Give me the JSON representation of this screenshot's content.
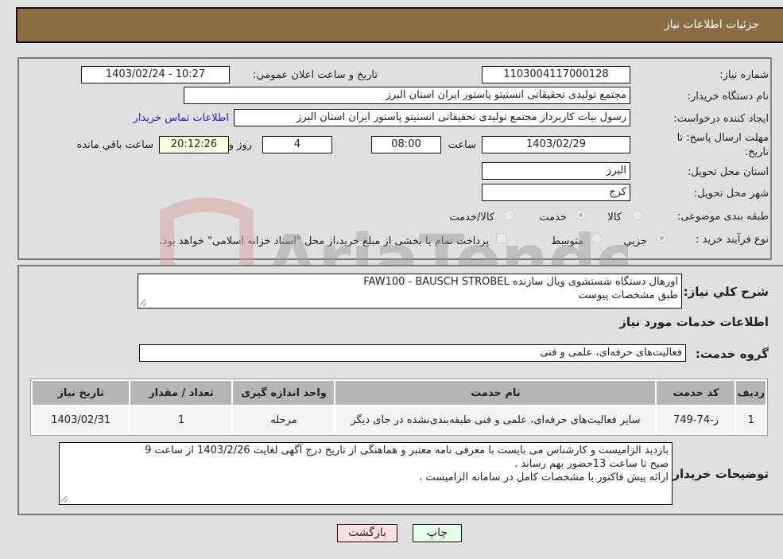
{
  "header": {
    "title": "جزئیات اطلاعات نیاز"
  },
  "details": {
    "need_number_label": "شماره نیاز:",
    "need_number": "1103004117000128",
    "announce_label": "تاريخ و ساعت اعلان عمومي:",
    "announce_value": "1403/02/24 - 10:27",
    "buyer_org_label": "نام دستگاه خریدار:",
    "buyer_org": "مجتمع تولیدی تحقیقاتی انستیتو پاستور ایران استان البرز",
    "requester_label": "ایجاد کننده درخواست:",
    "requester": "رسول بیات کاربرداز مجتمع تولیدی تحقیقاتی انستیتو پاستور ایران استان البرز",
    "contact_link": "اطلاعات تماس خریدار",
    "deadline_label": "مهلت ارسال پاسخ: تا تاریخ:",
    "deadline_date": "1403/02/29",
    "time_label": "ساعت",
    "deadline_time": "08:00",
    "days_value": "4",
    "days_label": "روز و",
    "remaining_time": "20:12:26",
    "remaining_label": "ساعت باقي مانده",
    "province_label": "استان محل تحویل:",
    "province": "البرز",
    "city_label": "شهر محل تحویل:",
    "city": "کرج",
    "category_label": "طبقه بندی موضوعی:",
    "category_options": [
      "کالا",
      "خدمت",
      "کالا/خدمت"
    ],
    "category_selected": "خدمت",
    "process_label": "نوع فرآیند خرید :",
    "process_options": [
      "جزيي",
      "متوسط"
    ],
    "process_selected": "جزيي",
    "treasury_note": "پرداخت تمام یا بخشی از مبلغ خرید،از محل \"اسناد خزانه اسلامی\" خواهد بود."
  },
  "summary": {
    "label": "شرح كلي نياز:",
    "line1": "اورهال دستگاه شستشوی ویال سازنده FAW100 - BAUSCH STROBEL",
    "line2": "طبق مشخصات پیوست"
  },
  "services": {
    "section_title": "اطلاعات خدمات مورد نیاز",
    "group_label": "گروه خدمت:",
    "group_value": "فعالیت‌های حرفه‌ای، علمی و فنی",
    "columns": [
      "ردیف",
      "کد خدمت",
      "نام خدمت",
      "واحد اندازه گیری",
      "تعداد / مقدار",
      "تاریخ نیاز"
    ],
    "rows": [
      [
        "1",
        "ز-74-749",
        "سایر فعالیت‌های حرفه‌ای، علمی و فنی طبقه‌بندی‌نشده در جای دیگر",
        "مرحله",
        "1",
        "1403/02/31"
      ]
    ]
  },
  "buyer_notes": {
    "label": "توضیحات خریدار:",
    "line1": "بازدید الزامیست و کارشناس می بایست با معرفی نامه معتبر و هماهنگی از تاریخ درج آگهی لغایت 1403/2/26 از ساعت 9",
    "line2": "صبح تا ساعت 13حضور بهم رساند .",
    "line3": "ارائه پیش فاکتور با مشخصات کامل در سامانه الزامیست ."
  },
  "buttons": {
    "print": "چاپ",
    "back": "بازگشت"
  },
  "watermark": {
    "text": "AriaTender.net"
  },
  "colors": {
    "header_bg": "#8c6d43",
    "link": "#2222cc",
    "back_btn": "#fde0e0",
    "print_btn": "#e8fde8"
  }
}
